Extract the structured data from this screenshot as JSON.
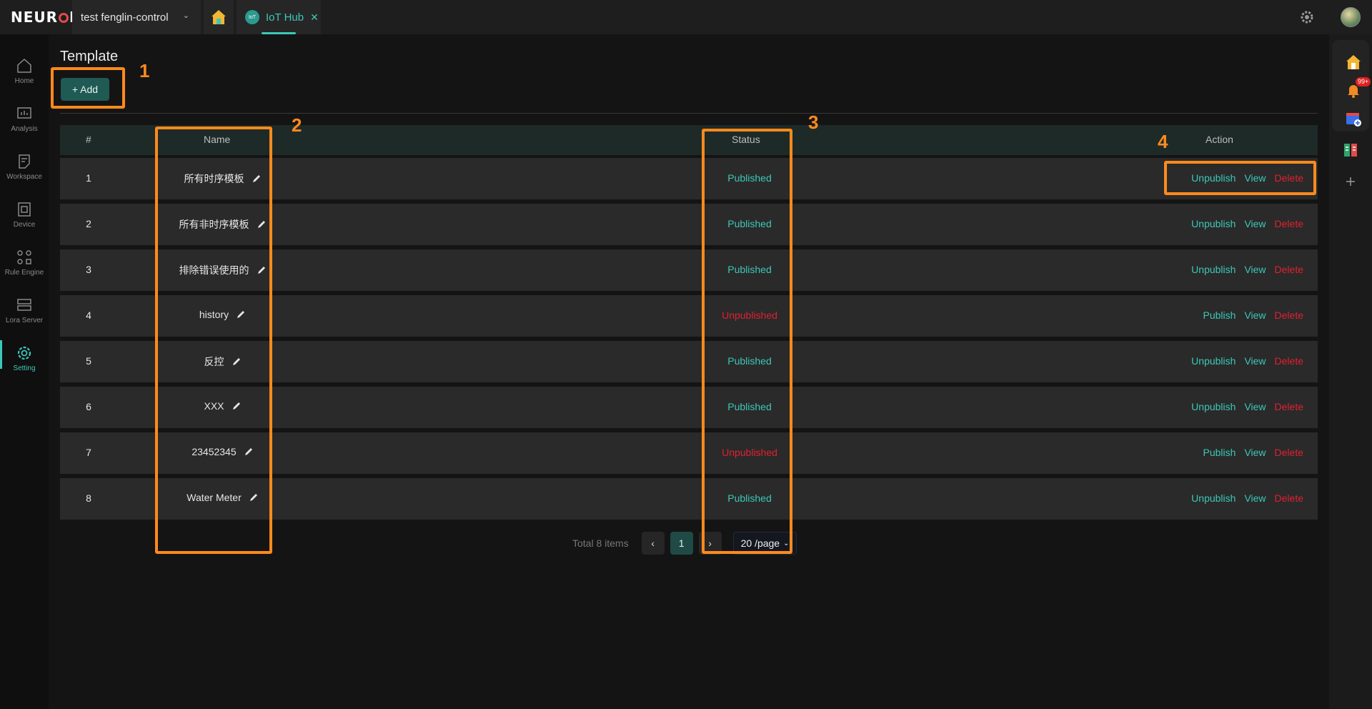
{
  "header": {
    "logo_text": "NEURON",
    "project_name": "test fenglin-control",
    "tab_label": "IoT Hub",
    "tab_icon_text": "IoT"
  },
  "sidebar": {
    "items": [
      {
        "label": "Home",
        "icon": "home-icon"
      },
      {
        "label": "Analysis",
        "icon": "analysis-icon"
      },
      {
        "label": "Workspace",
        "icon": "workspace-icon"
      },
      {
        "label": "Device",
        "icon": "device-icon"
      },
      {
        "label": "Rule Engine",
        "icon": "rule-engine-icon"
      },
      {
        "label": "Lora Server",
        "icon": "lora-server-icon"
      },
      {
        "label": "Setting",
        "icon": "gear-icon",
        "active": true
      }
    ]
  },
  "rightbar": {
    "notification_badge": "99+"
  },
  "page": {
    "title": "Template",
    "add_label": "+ Add"
  },
  "table": {
    "columns": [
      "#",
      "Name",
      "Status",
      "Action"
    ],
    "rows": [
      {
        "idx": "1",
        "name": "所有时序模板",
        "status": "Published",
        "actions": [
          "Unpublish",
          "View",
          "Delete"
        ]
      },
      {
        "idx": "2",
        "name": "所有非时序模板",
        "status": "Published",
        "actions": [
          "Unpublish",
          "View",
          "Delete"
        ]
      },
      {
        "idx": "3",
        "name": "排除错误使用的",
        "status": "Published",
        "actions": [
          "Unpublish",
          "View",
          "Delete"
        ]
      },
      {
        "idx": "4",
        "name": "history",
        "status": "Unpublished",
        "actions": [
          "Publish",
          "View",
          "Delete"
        ]
      },
      {
        "idx": "5",
        "name": "反控",
        "status": "Published",
        "actions": [
          "Unpublish",
          "View",
          "Delete"
        ]
      },
      {
        "idx": "6",
        "name": "XXX",
        "status": "Published",
        "actions": [
          "Unpublish",
          "View",
          "Delete"
        ]
      },
      {
        "idx": "7",
        "name": "23452345",
        "status": "Unpublished",
        "actions": [
          "Publish",
          "View",
          "Delete"
        ]
      },
      {
        "idx": "8",
        "name": "Water Meter",
        "status": "Published",
        "actions": [
          "Unpublish",
          "View",
          "Delete"
        ]
      }
    ]
  },
  "pagination": {
    "total_text": "Total 8 items",
    "current_page": "1",
    "page_size": "20 /page"
  },
  "annotations": {
    "labels": [
      "1",
      "2",
      "3",
      "4"
    ],
    "color": "#ff8a1c"
  },
  "colors": {
    "accent": "#3cc8b6",
    "danger": "#e02030",
    "highlight": "#ff8a1c"
  }
}
